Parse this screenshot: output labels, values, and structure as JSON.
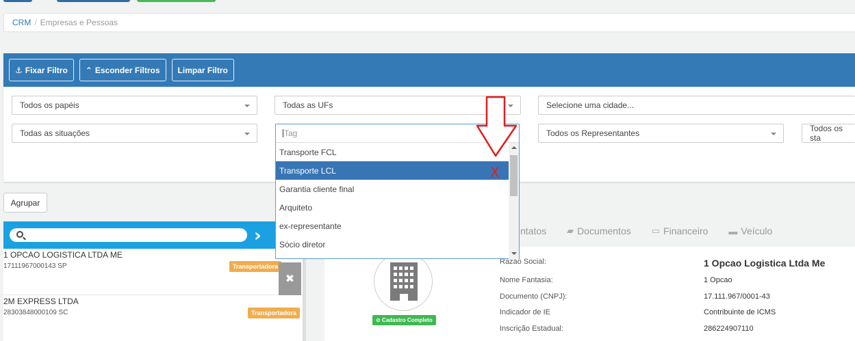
{
  "breadcrumb": {
    "root": "CRM",
    "separator": "/",
    "current": "Empresas e Pessoas"
  },
  "filter_bar": {
    "fixar": "Fixar Filtro",
    "esconder": "Esconder Filtros",
    "limpar": "Limpar Filtro"
  },
  "filters": {
    "papeis": "Todos os papéis",
    "ufs": "Todas as UFs",
    "cidade": "Selecione uma cidade...",
    "situacoes": "Todas as situações",
    "representantes": "Todos os Representantes",
    "status": "Todos os sta"
  },
  "tag_dropdown": {
    "placeholder": "Tag",
    "items": [
      "Transporte FCL",
      "Transporte LCL",
      "Garantia cliente final",
      "Arquiteto",
      "ex-representante",
      "Sócio diretor"
    ],
    "selected": "Transporte LCL"
  },
  "annotation": {
    "x_mark": "X"
  },
  "agrupar": "Agrupar",
  "companies": [
    {
      "name": "1 OPCAO LOGISTICA LTDA ME",
      "doc": "17111967000143  SP",
      "tag": "Transportadora"
    },
    {
      "name": "2M EXPRESS LTDA",
      "doc": "28303848000109  SC",
      "tag": "Transportadora"
    }
  ],
  "tabs": [
    "ntatos",
    "Documentos",
    "Financeiro",
    "Veículo"
  ],
  "detail": {
    "status_badge": "Cadastro Completo",
    "labels": [
      "Razão Social:",
      "Nome Fantasia:",
      "Documento (CNPJ):",
      "Indicador de IE",
      "Inscrição Estadual:"
    ],
    "values": [
      "1 Opcao Logistica Ltda Me",
      "1 Opcao",
      "17.111.967/0001-43",
      "Contribuinte de ICMS",
      "286224907110"
    ]
  }
}
